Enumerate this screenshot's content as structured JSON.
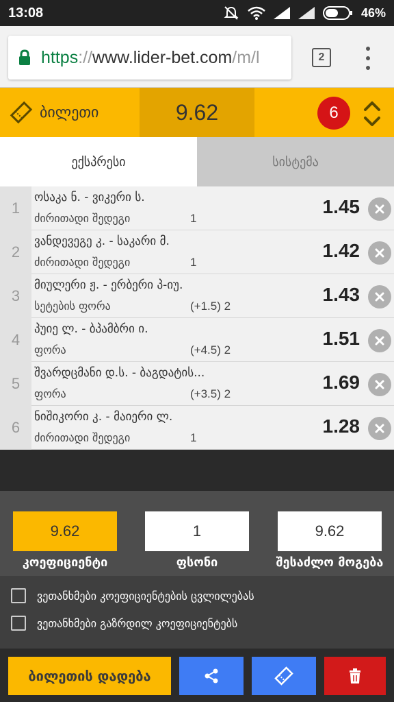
{
  "status_bar": {
    "time": "13:08",
    "battery": "46%"
  },
  "browser": {
    "url_scheme": "https",
    "url_sep": "://",
    "url_host": "www.lider-bet.com",
    "url_path": "/m/l",
    "tab_count": "2"
  },
  "ticket": {
    "title": "ბილეთი",
    "total_odds": "9.62",
    "selection_count": "6"
  },
  "tabs": [
    {
      "label": "ექსპრესი",
      "active": true
    },
    {
      "label": "სისტემა",
      "active": false
    }
  ],
  "bets": [
    {
      "num": "1",
      "match": "ოსაკა ნ. - ვიკერი ს.",
      "market": "ძირითადი შედეგი",
      "pick": "1",
      "odd": "1.45"
    },
    {
      "num": "2",
      "match": "ვანდევეგე კ. - საკარი მ.",
      "market": "ძირითადი შედეგი",
      "pick": "1",
      "odd": "1.42"
    },
    {
      "num": "3",
      "match": "მიულერი ჟ. - ერბერი პ-იუ.",
      "market": "სეტების ფორა",
      "pick": "(+1.5) 2",
      "odd": "1.43"
    },
    {
      "num": "4",
      "match": "პუიე ლ. - ბპამბრი ი.",
      "market": "ფორა",
      "pick": "(+4.5) 2",
      "odd": "1.51"
    },
    {
      "num": "5",
      "match": "შვარდცმანი დ.ს. - ბაგდატის...",
      "market": "ფორა",
      "pick": "(+3.5) 2",
      "odd": "1.69"
    },
    {
      "num": "6",
      "match": "ნიშიკორი კ. - მაიერი ლ.",
      "market": "ძირითადი შედეგი",
      "pick": "1",
      "odd": "1.28"
    }
  ],
  "summary": {
    "coefficient_value": "9.62",
    "coefficient_label": "კოეფიციენტი",
    "stake_value": "1",
    "stake_label": "ფსონი",
    "payout_value": "9.62",
    "payout_label": "შესაძლო მოგება"
  },
  "options": [
    {
      "label": "ვეთანხმები კოეფიციენტების ცვლილებას",
      "checked": false
    },
    {
      "label": "ვეთანხმები გაზრდილ კოეფიციენტებს",
      "checked": false
    }
  ],
  "actions": {
    "place_bet_label": "ბილეთის დადება",
    "share_icon": "share-icon",
    "ticket_icon": "ticket-icon",
    "delete_icon": "trash-icon"
  },
  "colors": {
    "brand_yellow": "#fbb800",
    "badge_red": "#d51416",
    "button_blue": "#3f7cf4",
    "button_red": "#d21a1a"
  }
}
